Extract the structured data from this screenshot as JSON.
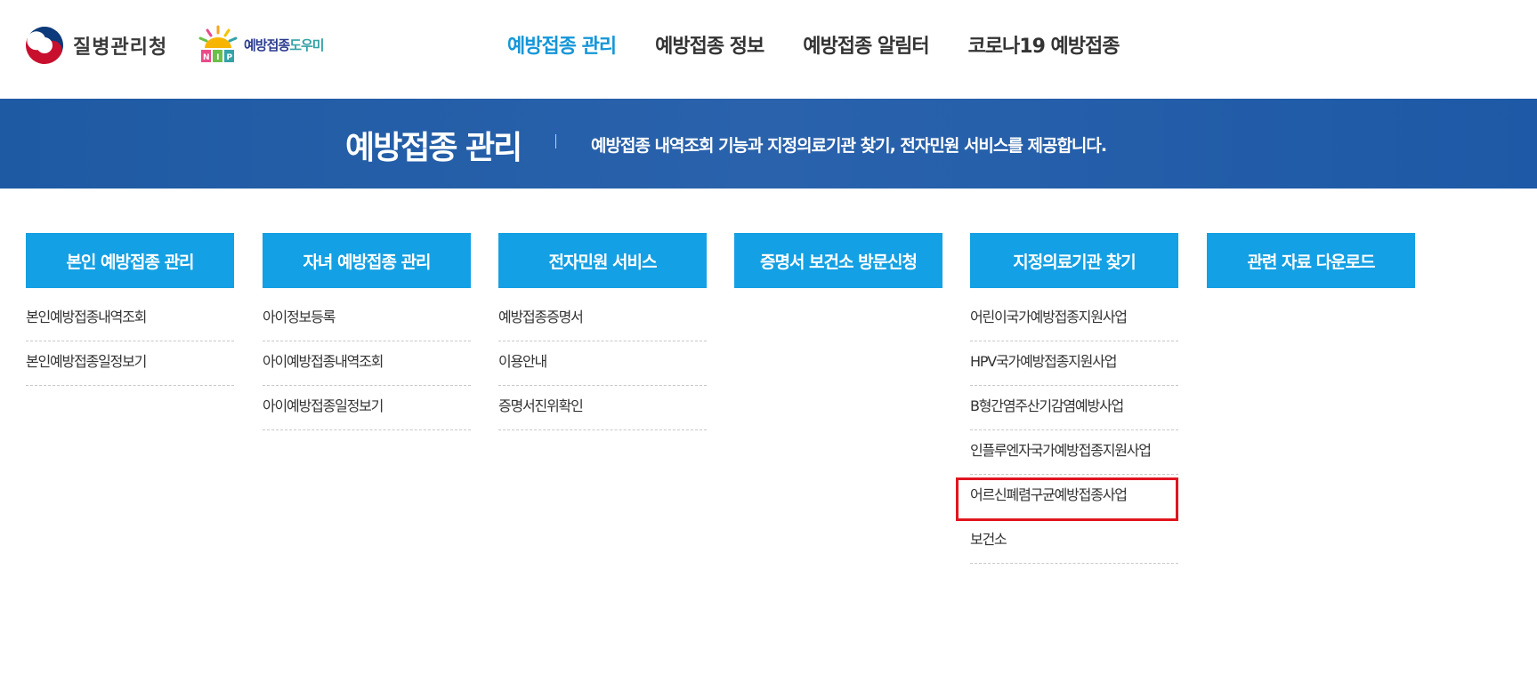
{
  "header": {
    "org_name": "질병관리청",
    "nip_logo_text": "예방접종",
    "nip_logo_text_alt": "도우미",
    "nav": [
      {
        "label": "예방접종 관리",
        "active": true
      },
      {
        "label": "예방접종 정보",
        "active": false
      },
      {
        "label": "예방접종 알림터",
        "active": false
      },
      {
        "label": "코로나19 예방접종",
        "active": false
      }
    ]
  },
  "banner": {
    "title": "예방접종 관리",
    "description": "예방접종 내역조회 기능과 지정의료기관 찾기, 전자민원 서비스를 제공합니다."
  },
  "menu": {
    "columns": [
      {
        "title": "본인 예방접종 관리",
        "items": [
          "본인예방접종내역조회",
          "본인예방접종일정보기"
        ]
      },
      {
        "title": "자녀 예방접종 관리",
        "items": [
          "아이정보등록",
          "아이예방접종내역조회",
          "아이예방접종일정보기"
        ]
      },
      {
        "title": "전자민원 서비스",
        "items": [
          "예방접종증명서",
          "이용안내",
          "증명서진위확인"
        ]
      },
      {
        "title": "증명서 보건소 방문신청",
        "items": []
      },
      {
        "title": "지정의료기관 찾기",
        "items": [
          "어린이국가예방접종지원사업",
          "HPV국가예방접종지원사업",
          "B형간염주산기감염예방사업",
          "인플루엔자국가예방접종지원사업",
          "어르신폐렴구균예방접종사업",
          "보건소"
        ]
      },
      {
        "title": "관련 자료 다운로드",
        "items": []
      }
    ]
  },
  "highlight": {
    "label": "어르신폐렴구균예방접종사업",
    "color": "#e0151f"
  },
  "colors": {
    "accent": "#14a0e4",
    "active_nav": "#1596d8",
    "banner": "#2a62ac"
  }
}
